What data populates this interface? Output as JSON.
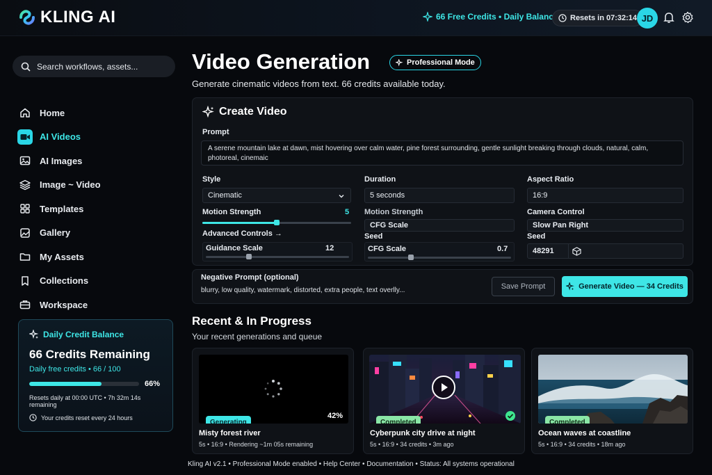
{
  "app": {
    "logo_text": "KLING AI",
    "credits_top": "66 Free Credits • Daily Balance",
    "reset_timer": "Resets in 07:32:14",
    "avatar_initials": "JD",
    "accent": "#3ee6e6"
  },
  "sidebar": {
    "search_placeholder": "Search workflows, assets...",
    "items": [
      {
        "label": "Home",
        "icon": "home-icon",
        "active": false
      },
      {
        "label": "AI Videos",
        "icon": "video-icon",
        "active": true
      },
      {
        "label": "AI Images",
        "icon": "image-icon",
        "active": false
      },
      {
        "label": "Image ~ Video",
        "icon": "layers-icon",
        "active": false
      },
      {
        "label": "Templates",
        "icon": "grid-icon",
        "active": false
      },
      {
        "label": "Gallery",
        "icon": "gallery-icon",
        "active": false
      },
      {
        "label": "My Assets",
        "icon": "folder-icon",
        "active": false
      },
      {
        "label": "Collections",
        "icon": "bookmark-icon",
        "active": false
      },
      {
        "label": "Workspace",
        "icon": "briefcase-icon",
        "active": false
      }
    ],
    "credit_card": {
      "title": "Daily Credit Balance",
      "remaining": "66 Credits Remaining",
      "subtitle": "Daily free credits • 66 / 100",
      "percent_label": "66%",
      "percent_value": 0.66,
      "reset_text": "Resets daily at 00:00 UTC • 7h 32m 14s remaining",
      "footer_text": "Your credits reset every 24 hours"
    }
  },
  "main": {
    "title": "Video Generation",
    "mode_badge": "Professional Mode",
    "subtitle": "Generate cinematic videos from text. 66 credits available today.",
    "create": {
      "title": "Create Video",
      "prompt_label": "Prompt",
      "prompt_value": "A serene mountain lake at dawn, mist hovering over calm water, pine forest surrounding, gentle sunlight breaking through clouds, natural, calm, photoreal, cinemaic",
      "style_label": "Style",
      "style_value": "Cinematic",
      "duration_label": "Duration",
      "duration_value": "5 seconds",
      "aspect_label": "Aspect Ratio",
      "aspect_value": "16:9",
      "motion_label": "Motion Strength",
      "motion_value": "5",
      "motion_fraction": 0.5,
      "motion_label_2": "Motion Strength",
      "cfg_label": "CFG Scale",
      "camera_label": "Camera Control",
      "camera_value": "Slow Pan Right",
      "advanced_label": "Advanced Controls →",
      "seed_label": "Seed",
      "seed_label_2": "Seed",
      "guidance_label": "Guidance Scale",
      "guidance_value": "12",
      "guidance_fraction": 0.3,
      "cfg_slider_label": "CFG Scale",
      "cfg_value": "0.7",
      "cfg_fraction": 0.3,
      "seed_value": "48291"
    },
    "negative": {
      "label": "Negative Prompt (optional)",
      "value": "blurry, low quality, watermark, distorted, extra people, text overlly...",
      "save_label": "Save Prompt",
      "generate_label": "Generate Video — 34 Credits"
    },
    "recent": {
      "title": "Recent & In Progress",
      "subtitle": "Your recent generations and queue",
      "cards": [
        {
          "status": "Generating",
          "progress": "42%",
          "title": "Misty forest river",
          "meta": "5s • 16:9 • Rendering ~1m 05s remaining"
        },
        {
          "status": "Completed",
          "title": "Cyberpunk city drive at night",
          "meta": "5s • 16:9 • 34 credits • 3m ago"
        },
        {
          "status": "Completed",
          "title": "Ocean waves at coastline",
          "meta": "5s • 16:9 • 34 credits • 18m ago"
        }
      ]
    }
  },
  "footer": {
    "text": "Kling AI v2.1 • Professional Mode enabled • Help Center • Documentation • Status: All systems operational"
  }
}
